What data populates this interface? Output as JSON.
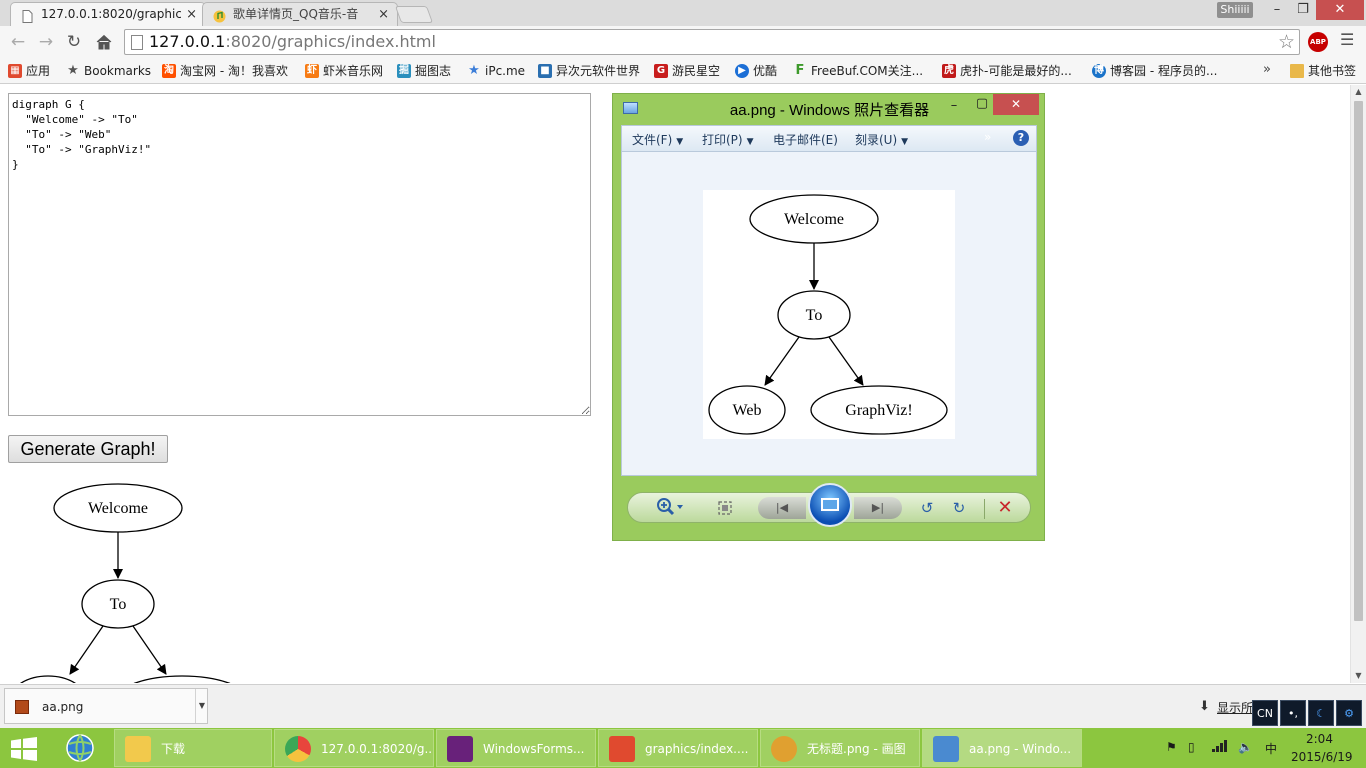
{
  "browser": {
    "tabs": [
      {
        "label": "127.0.0.1:8020/graphics",
        "close": "×"
      },
      {
        "label": "歌单详情页_QQ音乐-音",
        "close": "×"
      }
    ],
    "profile": "Shiiiii",
    "window_controls": {
      "minimize": "–",
      "maximize": "❐",
      "close": "✕"
    },
    "url_host": "127.0.0.1",
    "url_rest": ":8020/graphics/index.html",
    "abp": "ABP",
    "bookmarks": [
      {
        "label": "应用",
        "color": "#e04a2f",
        "glyph": "▦"
      },
      {
        "label": "Bookmarks",
        "color": "#555555",
        "glyph": "★"
      },
      {
        "label": "淘宝网 - 淘！我喜欢",
        "color": "#ff5000",
        "glyph": "淘"
      },
      {
        "label": "虾米音乐网",
        "color": "#f77b13",
        "glyph": "虾"
      },
      {
        "label": "掘图志",
        "color": "#2a8fbd",
        "glyph": "掘"
      },
      {
        "label": "iPc.me",
        "color": "#3b7dd8",
        "glyph": "★"
      },
      {
        "label": "异次元软件世界",
        "color": "#2a6fb0",
        "glyph": "■"
      },
      {
        "label": "游民星空",
        "color": "#c81d1d",
        "glyph": "G"
      },
      {
        "label": "优酷",
        "color": "#1c6fd6",
        "glyph": "▶"
      },
      {
        "label": "FreeBuf.COM关注...",
        "color": "#3d9a2b",
        "glyph": "F"
      },
      {
        "label": "虎扑-可能是最好的...",
        "color": "#c01a1a",
        "glyph": "虎"
      },
      {
        "label": "博客园 - 程序员的...",
        "color": "#1a73c9",
        "glyph": "博"
      }
    ],
    "bookmarks_more": "»",
    "other_bookmarks": "其他书签"
  },
  "page": {
    "dot_source": "digraph G {\n  \"Welcome\" -> \"To\"\n  \"To\" -> \"Web\"\n  \"To\" -> \"GraphViz!\"\n}",
    "generate_button": "Generate Graph!",
    "graph_nodes": {
      "welcome": "Welcome",
      "to": "To",
      "web": "Web",
      "graphviz": "GraphViz!"
    }
  },
  "photo_viewer": {
    "title": "aa.png - Windows 照片查看器",
    "menus": [
      "文件(F)",
      "打印(P)",
      "电子邮件(E)",
      "刻录(U)"
    ],
    "more": "»",
    "help": "?"
  },
  "downloads": {
    "file": "aa.png",
    "show_all": "显示所"
  },
  "ime": {
    "lang": "CN",
    "punct": "•,",
    "moon": "☾",
    "settings": "⚙"
  },
  "taskbar": {
    "apps": [
      {
        "label": "下载",
        "color": "#f2c94c"
      },
      {
        "label": "127.0.0.1:8020/g...",
        "color": "#e8453c"
      },
      {
        "label": "WindowsForms...",
        "color": "#68217a"
      },
      {
        "label": "graphics/index....",
        "color": "#e04a2f"
      },
      {
        "label": "无标题.png - 画图",
        "color": "#e0a030"
      },
      {
        "label": "aa.png - Windo...",
        "color": "#4a8ad0"
      }
    ],
    "ime_indicator": "中",
    "time": "2:04",
    "date": "2015/6/19"
  }
}
